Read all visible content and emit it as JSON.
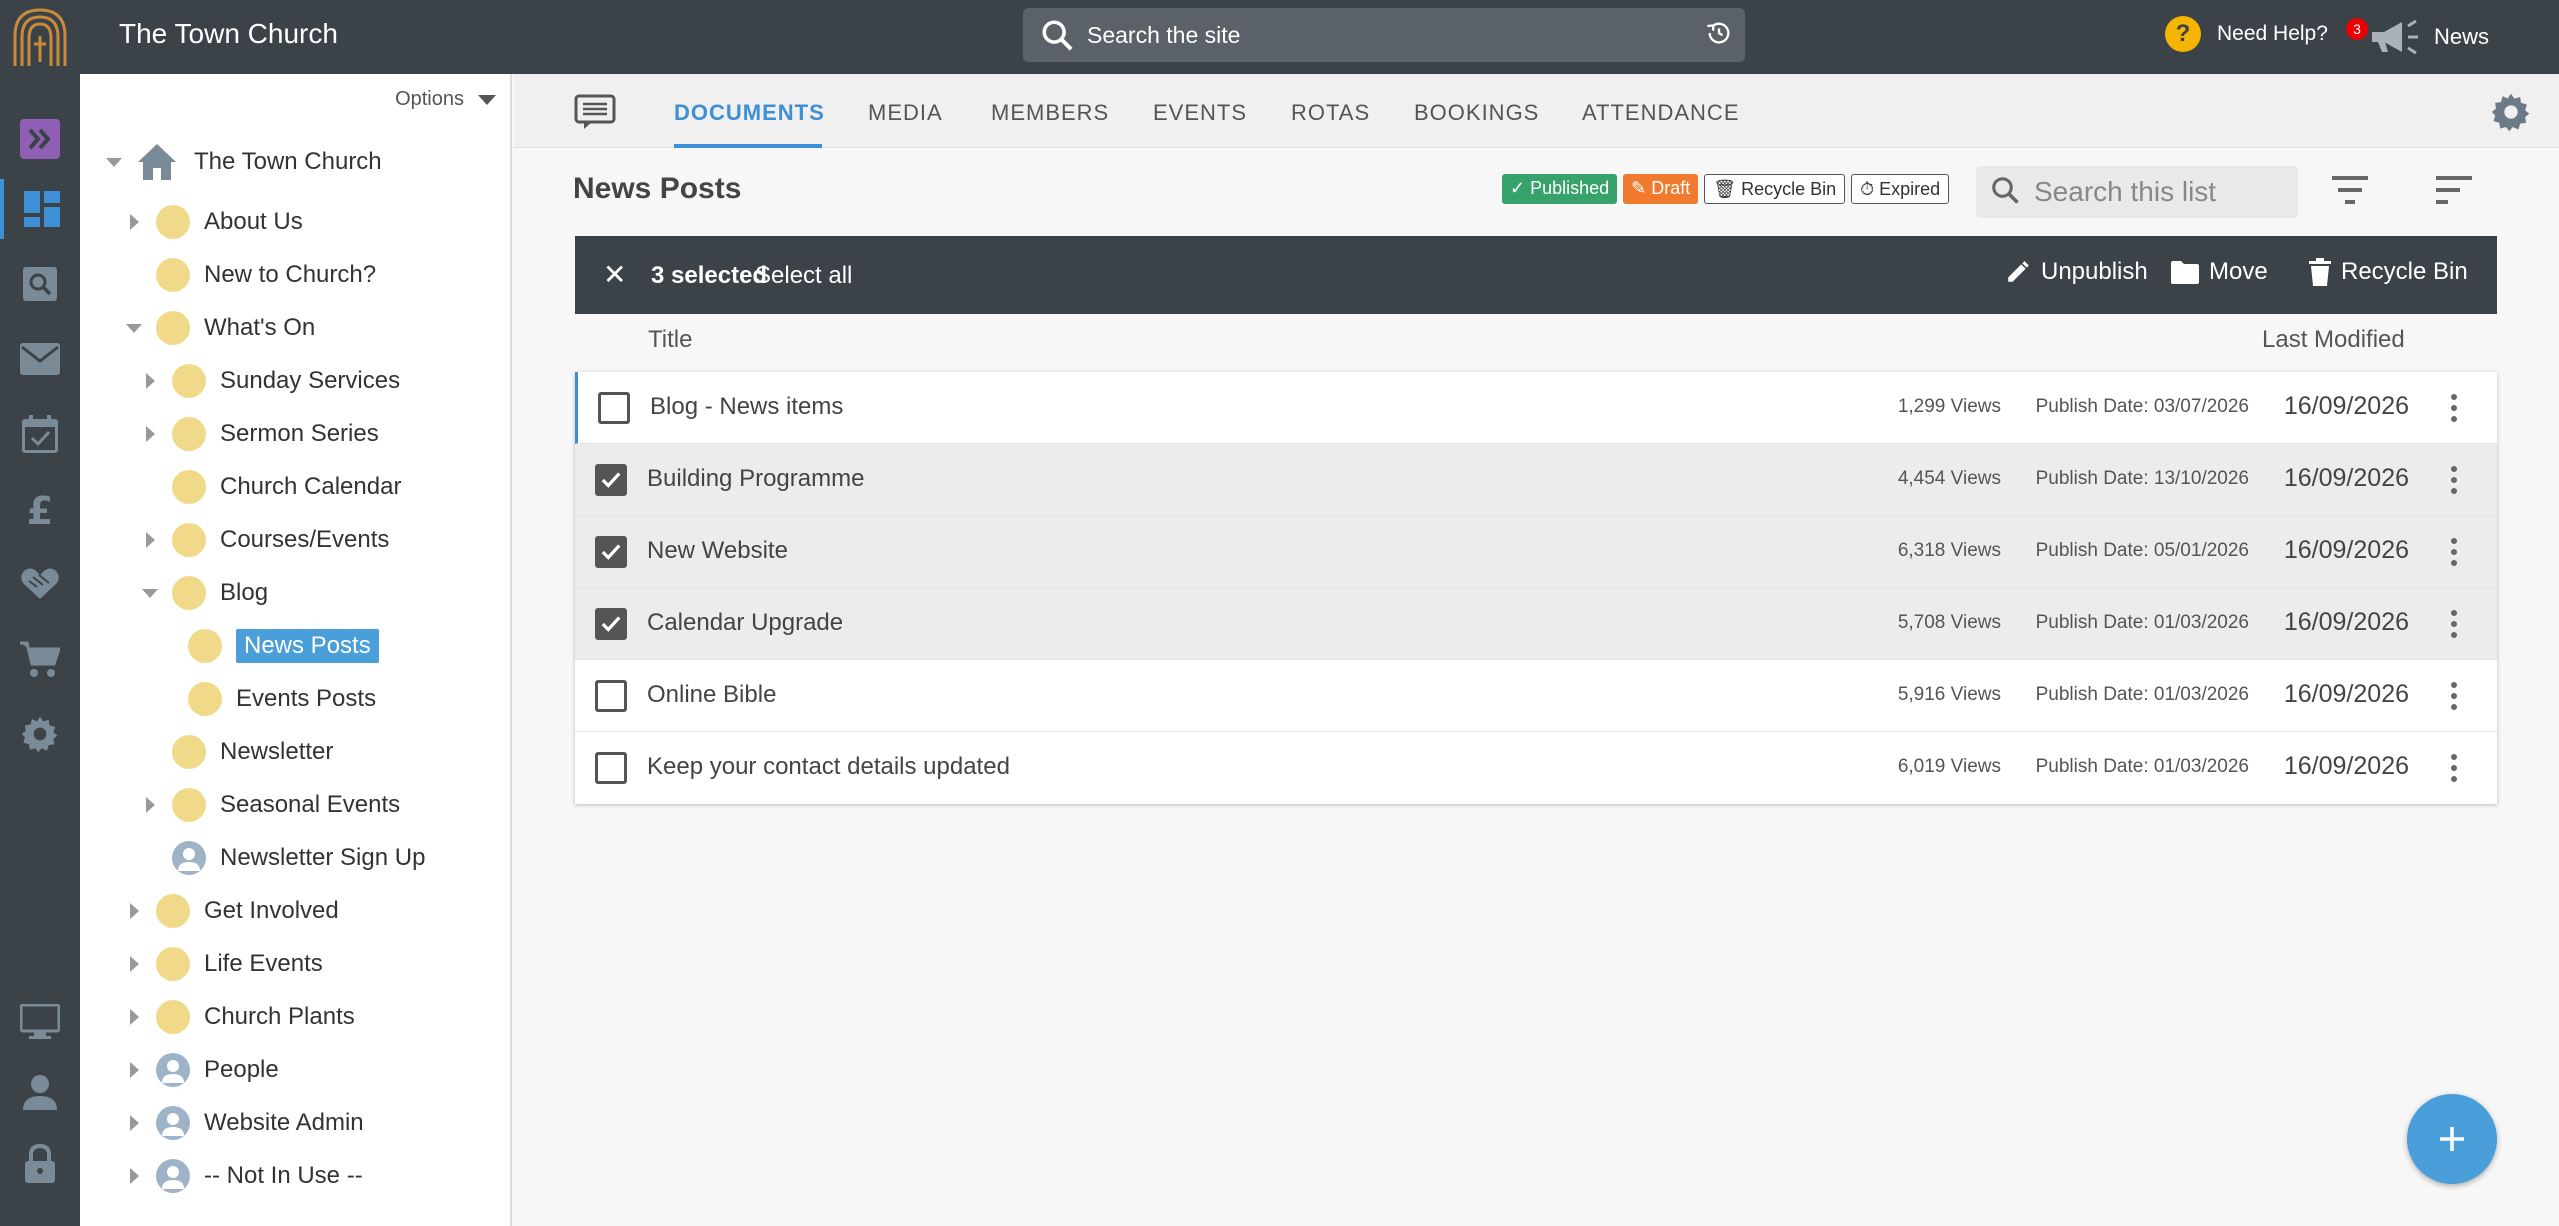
{
  "header": {
    "site_title": "The Town Church",
    "search_placeholder": "Search the site",
    "help_label": "Need Help?",
    "news_count": "3",
    "news_label": "News"
  },
  "rail": {
    "icons": [
      "expand-icon",
      "dashboard-icon",
      "search-icon",
      "mail-icon",
      "calendar-check-icon",
      "pound-icon",
      "handshake-icon",
      "cart-icon",
      "settings-icon",
      "monitor-icon",
      "user-icon",
      "lock-icon"
    ],
    "active": "dashboard-icon"
  },
  "tree": {
    "options_label": "Options",
    "root": "The Town Church",
    "nodes": [
      {
        "label": "About Us"
      },
      {
        "label": "New to Church?"
      },
      {
        "label": "What's On"
      },
      {
        "label": "Sunday Services"
      },
      {
        "label": "Sermon Series"
      },
      {
        "label": "Church Calendar"
      },
      {
        "label": "Courses/Events"
      },
      {
        "label": "Blog"
      },
      {
        "label": "News Posts"
      },
      {
        "label": "Events Posts"
      },
      {
        "label": "Newsletter"
      },
      {
        "label": "Seasonal Events"
      },
      {
        "label": "Newsletter Sign Up"
      },
      {
        "label": "Get Involved"
      },
      {
        "label": "Life Events"
      },
      {
        "label": "Church Plants"
      },
      {
        "label": "People"
      },
      {
        "label": "Website Admin"
      },
      {
        "label": "-- Not In Use --"
      }
    ]
  },
  "tabs": [
    "DOCUMENTS",
    "MEDIA",
    "MEMBERS",
    "EVENTS",
    "ROTAS",
    "BOOKINGS",
    "ATTENDANCE"
  ],
  "list": {
    "title": "News Posts",
    "chips": {
      "published": "✓ Published",
      "draft": "✎ Draft",
      "recycle": "🗑 Recycle Bin",
      "expired": "⏱ Expired"
    },
    "search_placeholder": "Search this list",
    "selection": {
      "count": "3 selected",
      "select_all": "Select all",
      "unpublish": "Unpublish",
      "move": "Move",
      "recycle": "Recycle Bin"
    },
    "columns": {
      "title": "Title",
      "modified": "Last Modified"
    },
    "rows": [
      {
        "title": "Blog - News items",
        "views": "1,299 Views",
        "publish": "Publish Date: 03/07/2026",
        "modified": "16/09/2026",
        "checked": false
      },
      {
        "title": "Building Programme",
        "views": "4,454 Views",
        "publish": "Publish Date: 13/10/2026",
        "modified": "16/09/2026",
        "checked": true
      },
      {
        "title": "New Website",
        "views": "6,318 Views",
        "publish": "Publish Date: 05/01/2026",
        "modified": "16/09/2026",
        "checked": true
      },
      {
        "title": "Calendar Upgrade",
        "views": "5,708 Views",
        "publish": "Publish Date: 01/03/2026",
        "modified": "16/09/2026",
        "checked": true
      },
      {
        "title": "Online Bible",
        "views": "5,916 Views",
        "publish": "Publish Date: 01/03/2026",
        "modified": "16/09/2026",
        "checked": false
      },
      {
        "title": "Keep your contact details updated",
        "views": "6,019 Views",
        "publish": "Publish Date: 01/03/2026",
        "modified": "16/09/2026",
        "checked": false
      }
    ]
  },
  "colors": {
    "accent": "#3d8fd6",
    "header": "#3b4349",
    "published": "#37a36b",
    "draft": "#f07a2d",
    "folder": "#f1d98a"
  }
}
